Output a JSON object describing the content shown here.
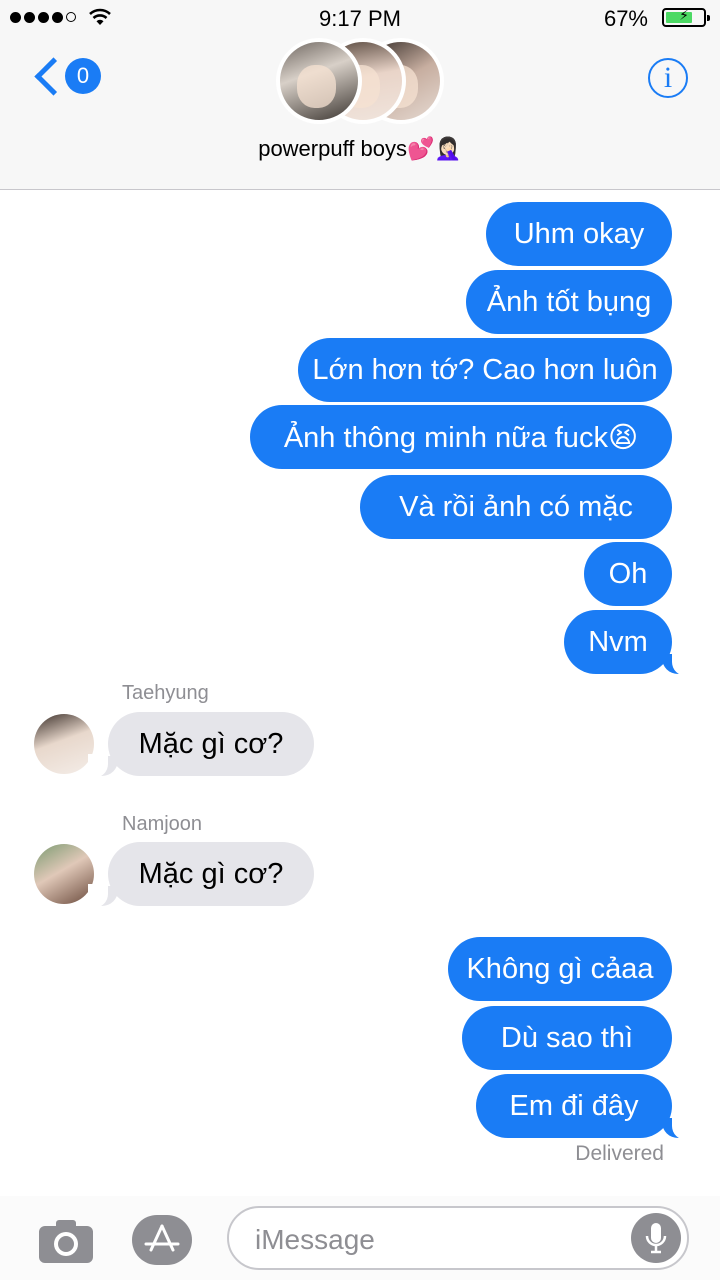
{
  "status_bar": {
    "time": "9:17 PM",
    "battery_percent": "67%",
    "battery_level": 0.67,
    "signal_bars_filled": 4,
    "signal_bars_total": 5
  },
  "header": {
    "back_badge": "0",
    "group_name": "powerpuff boys💕🤦🏻‍♀️",
    "info_glyph": "i"
  },
  "messages": {
    "m1": "Uhm okay",
    "m2": "Ảnh tốt bụng",
    "m3": "Lớn hơn tớ? Cao hơn luôn",
    "m4": "Ảnh thông minh nữa fuck😫",
    "m5": "Và rồi ảnh có mặc",
    "m6": "Oh",
    "m7": "Nvm",
    "t_sender": "Taehyung",
    "t_text": "Mặc gì cơ?",
    "n_sender": "Namjoon",
    "n_text": "Mặc gì cơ?",
    "m8": "Không gì cảaa",
    "m9": "Dù sao thì",
    "m10": "Em đi đây",
    "delivered": "Delivered"
  },
  "input": {
    "placeholder": "iMessage"
  },
  "colors": {
    "outgoing": "#1a7cf5",
    "incoming": "#e5e5ea",
    "accent": "#1a7cf5"
  }
}
